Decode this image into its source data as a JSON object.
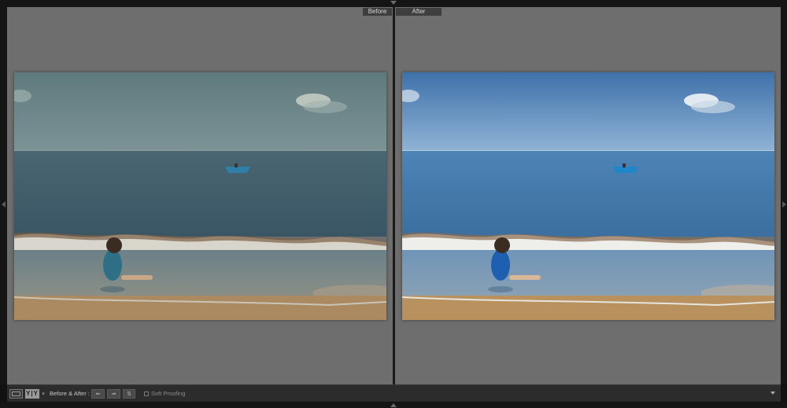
{
  "panes": {
    "before_label": "Before",
    "after_label": "After"
  },
  "toolbar": {
    "view_icon": "loupe-view-icon",
    "yy_label": "Y|Y",
    "yy_caret": "▾",
    "before_after_label": "Before & After :",
    "swap_icons": [
      "copy-before-to-after-icon",
      "copy-after-to-before-icon",
      "swap-before-after-icon"
    ],
    "swap_glyphs": [
      "⇐",
      "⇒",
      "⇅"
    ],
    "soft_proofing_label": "Soft Proofing",
    "soft_proofing_checked": false,
    "menu_icon": "toolbar-menu-caret-icon"
  },
  "colors": {
    "workspace_gray": "#6e6e6e",
    "toolbar": "#2c2c2c",
    "before_sky": "#5f7a7d",
    "after_sky": "#4e80b8",
    "before_sea": "#3c5a6c",
    "after_sea": "#3f76a8",
    "sand": "#b08a5e"
  }
}
